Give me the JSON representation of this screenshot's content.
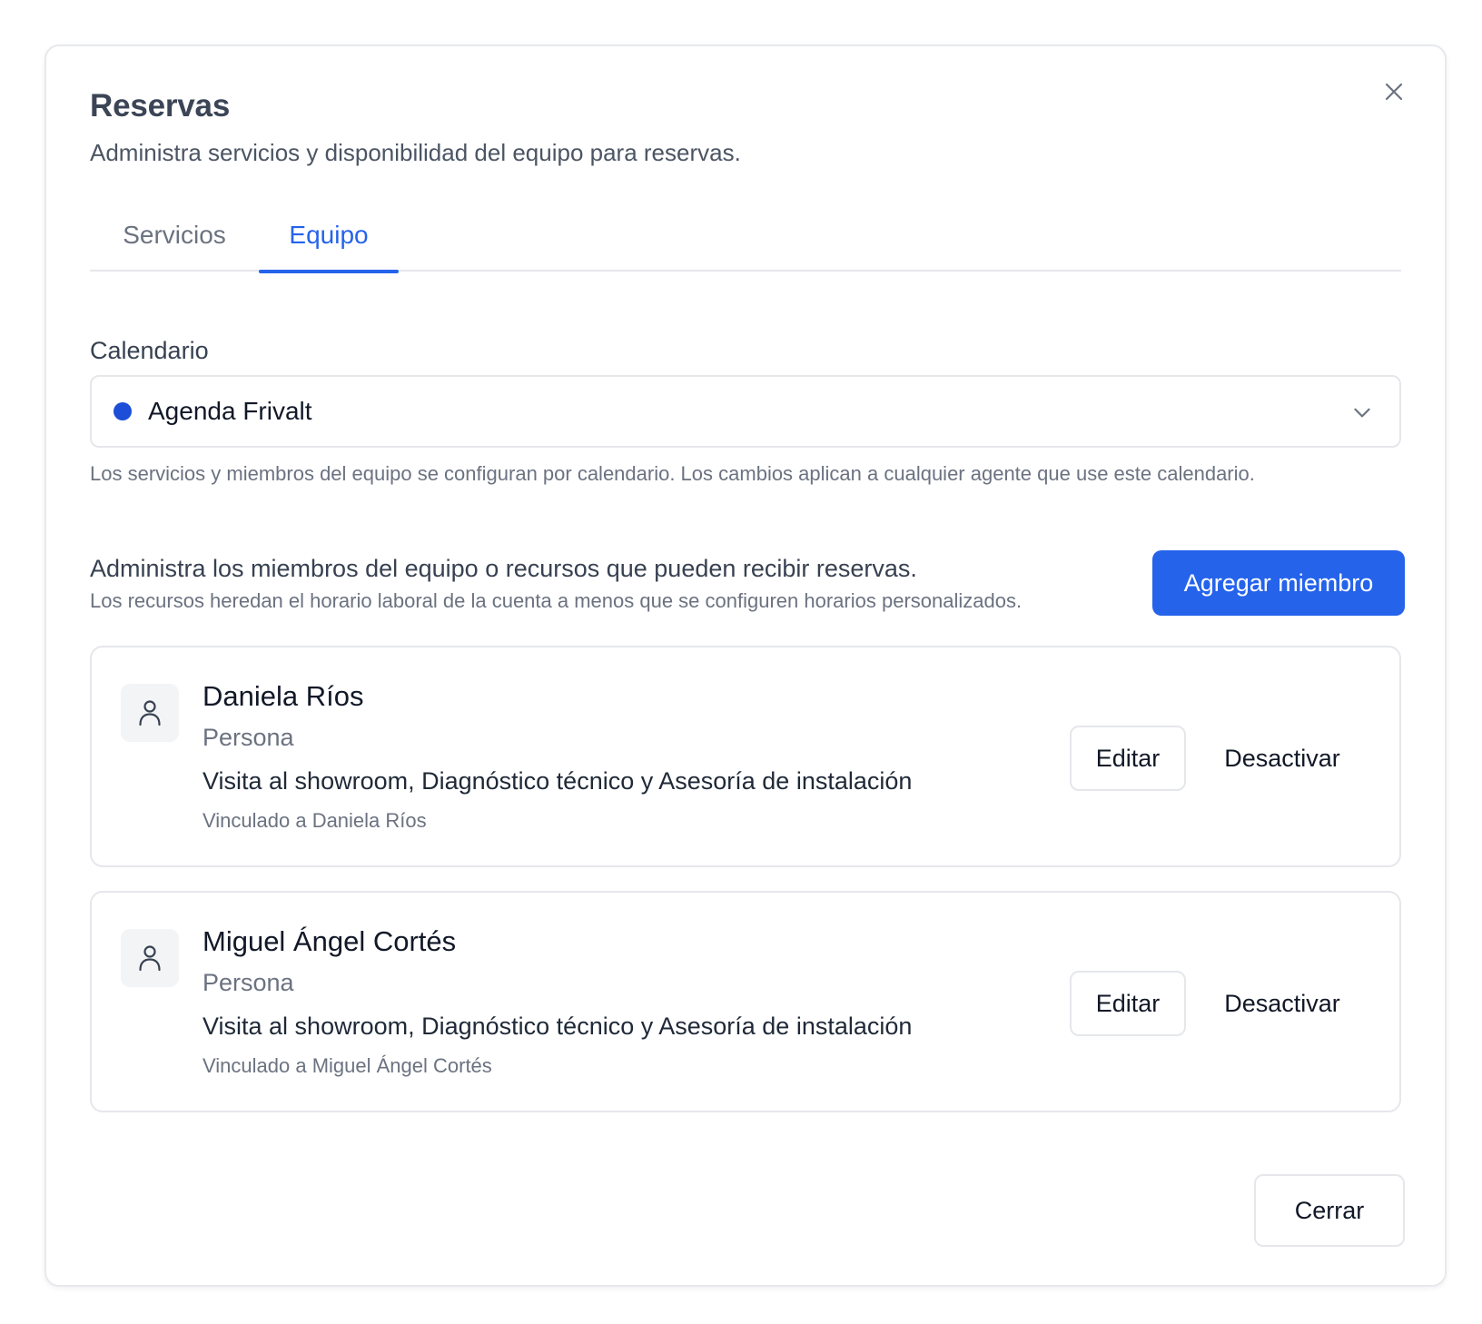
{
  "dialog": {
    "title": "Reservas",
    "subtitle": "Administra servicios y disponibilidad del equipo para reservas.",
    "close_icon": "close-icon"
  },
  "tabs": [
    {
      "label": "Servicios",
      "active": false
    },
    {
      "label": "Equipo",
      "active": true
    }
  ],
  "calendar": {
    "label": "Calendario",
    "selected": "Agenda Frivalt",
    "dot_color": "#1d4ed8",
    "help": "Los servicios y miembros del equipo se configuran por calendario. Los cambios aplican a cualquier agente que use este calendario."
  },
  "team": {
    "description": "Administra los miembros del equipo o recursos que pueden recibir reservas.",
    "note": "Los recursos heredan el horario laboral de la cuenta a menos que se configuren horarios personalizados.",
    "add_button": "Agregar miembro",
    "members": [
      {
        "name": "Daniela Ríos",
        "type": "Persona",
        "services": "Visita al showroom, Diagnóstico técnico y Asesoría de instalación",
        "linked": "Vinculado a Daniela Ríos",
        "edit_label": "Editar",
        "deactivate_label": "Desactivar"
      },
      {
        "name": "Miguel Ángel Cortés",
        "type": "Persona",
        "services": "Visita al showroom, Diagnóstico técnico y Asesoría de instalación",
        "linked": "Vinculado a Miguel Ángel Cortés",
        "edit_label": "Editar",
        "deactivate_label": "Desactivar"
      }
    ]
  },
  "footer": {
    "close_label": "Cerrar"
  },
  "colors": {
    "accent": "#2563eb",
    "border": "#e5e7eb"
  }
}
